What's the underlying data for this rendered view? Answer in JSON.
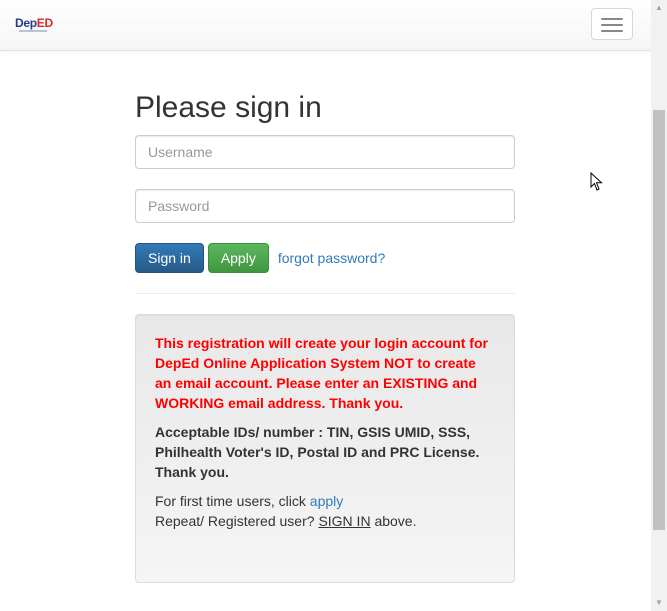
{
  "navbar": {
    "logo": "DepED",
    "menu_icon": "hamburger-icon"
  },
  "login": {
    "title": "Please sign in",
    "username_placeholder": "Username",
    "password_placeholder": "Password",
    "sign_in_label": "Sign in",
    "apply_label": "Apply",
    "forgot_label": "forgot password?"
  },
  "notice": {
    "warning": "This registration will create your login account for DepEd Online Application System NOT to create an email account. Please enter an EXISTING and WORKING email address. Thank you.",
    "ids": "Acceptable IDs/ number : TIN, GSIS UMID, SSS, Philhealth Voter's ID, Postal ID and PRC License. Thank you.",
    "first_time_prefix": "For first time users, click",
    "apply_link": "apply",
    "repeat_prefix": "Repeat/ Registered user?",
    "sign_in_link": "SIGN IN",
    "repeat_suffix": "above."
  },
  "colors": {
    "primary": "#337ab7",
    "success": "#5cb85c",
    "warning_text": "#ff0000",
    "logo_blue": "#1f3d8a",
    "logo_red": "#d62b2b"
  }
}
